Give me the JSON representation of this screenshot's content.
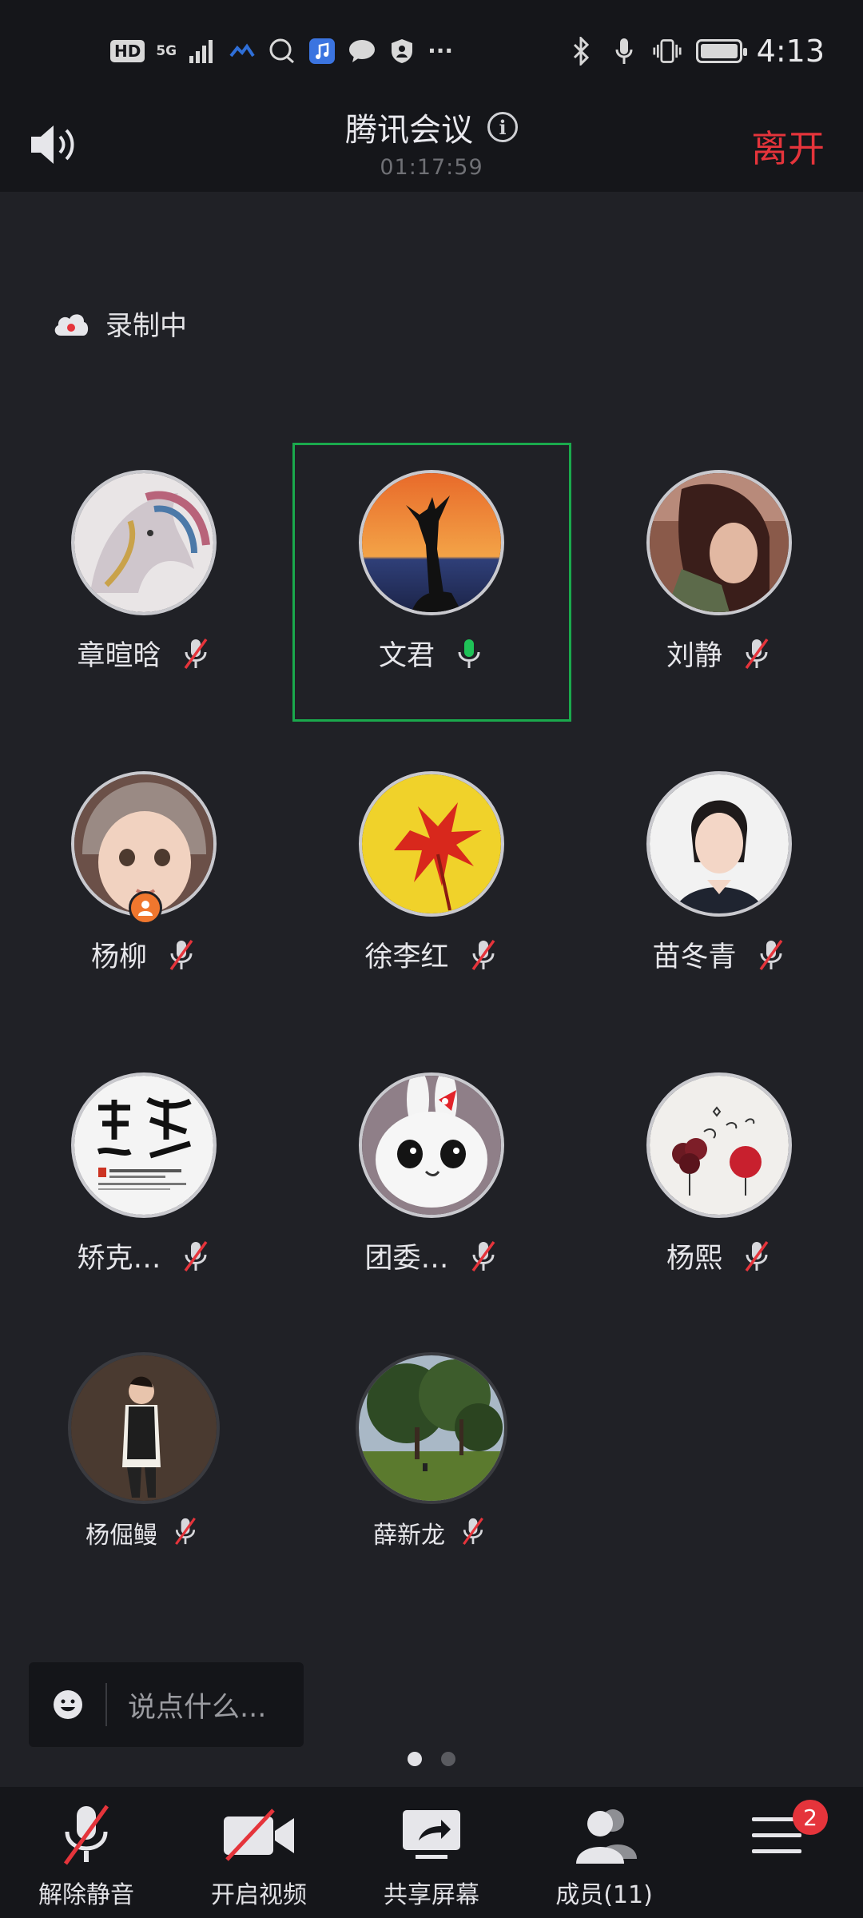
{
  "status_bar": {
    "hd_tag": "HD",
    "network": "5G",
    "time": "4:13",
    "more": "···",
    "icons": [
      "signal-icon",
      "cloud-icon",
      "chat-bubble-icon",
      "music-app-icon",
      "message-icon",
      "shield-icon",
      "bluetooth-icon",
      "mic-icon",
      "vibrate-icon",
      "battery-icon"
    ]
  },
  "header": {
    "title": "腾讯会议",
    "timer": "01:17:59",
    "leave_label": "离开"
  },
  "recording": {
    "label": "录制中"
  },
  "participants": [
    {
      "name": "章暄晗",
      "mic": "muted"
    },
    {
      "name": "文君",
      "mic": "active"
    },
    {
      "name": "刘静",
      "mic": "muted"
    },
    {
      "name": "杨柳",
      "mic": "muted",
      "host": true
    },
    {
      "name": "徐李红",
      "mic": "muted"
    },
    {
      "name": "苗冬青",
      "mic": "muted"
    },
    {
      "name": "矫克…",
      "mic": "muted"
    },
    {
      "name": "团委…",
      "mic": "muted"
    },
    {
      "name": "杨熙",
      "mic": "muted"
    },
    {
      "name": "杨倔鳗",
      "mic": "muted"
    },
    {
      "name": "薛新龙",
      "mic": "muted"
    }
  ],
  "chat": {
    "placeholder": "说点什么..."
  },
  "pager": {
    "pages": 2,
    "current": 1
  },
  "toolbar": {
    "unmute_label": "解除静音",
    "video_label": "开启视频",
    "share_label": "共享屏幕",
    "members_label": "成员(11)",
    "more_badge": "2"
  },
  "colors": {
    "leave": "#e5343b",
    "active_speaker": "#1aa94c",
    "host_badge": "#f0772e",
    "muted_slash": "#e5343b"
  }
}
